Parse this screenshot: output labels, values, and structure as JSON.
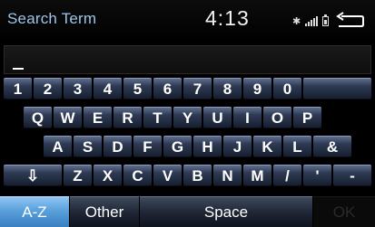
{
  "header": {
    "title": "Search Term",
    "clock": "4:13"
  },
  "status_icons": [
    "bluetooth-icon",
    "signal-icon",
    "battery-icon"
  ],
  "input": {
    "value": ""
  },
  "keyboard": {
    "row1": [
      "1",
      "2",
      "3",
      "4",
      "5",
      "6",
      "7",
      "8",
      "9",
      "0"
    ],
    "row2": [
      "Q",
      "W",
      "E",
      "R",
      "T",
      "Y",
      "U",
      "I",
      "O",
      "P"
    ],
    "row3": [
      "A",
      "S",
      "D",
      "F",
      "G",
      "H",
      "J",
      "K",
      "L",
      "&"
    ],
    "row4": [
      "⇩",
      "Z",
      "X",
      "C",
      "V",
      "B",
      "N",
      "M",
      "/",
      "'",
      "-"
    ]
  },
  "footer": {
    "az": "A-Z",
    "other": "Other",
    "space": "Space",
    "ok": "OK"
  },
  "colors": {
    "title": "#9ec6ec",
    "active_tab": "#5aa0dc",
    "key": "#2f3b55"
  }
}
